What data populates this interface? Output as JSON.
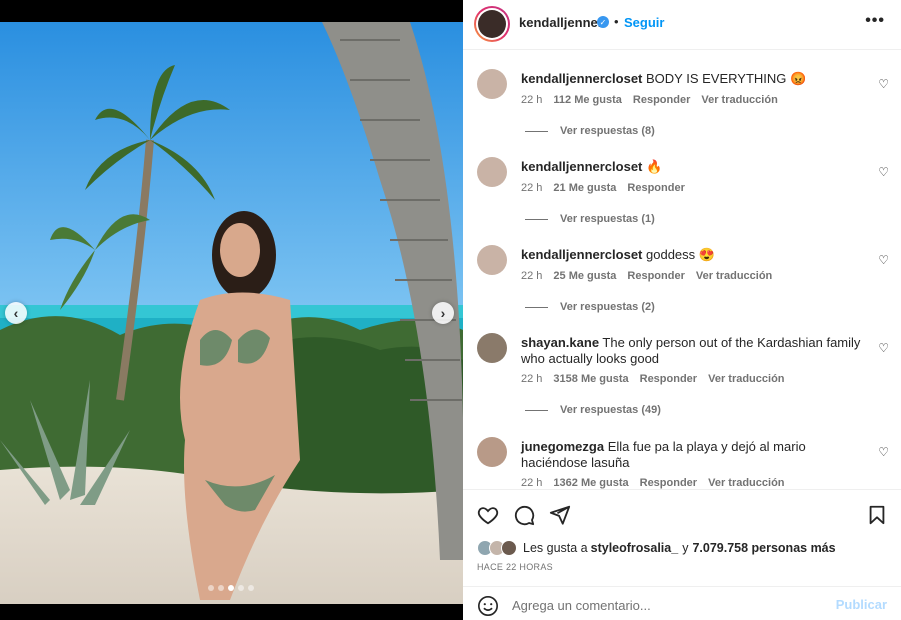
{
  "post": {
    "username": "kendalljenner",
    "follow_label": "Seguir",
    "separator": "•",
    "more": "•••"
  },
  "comments": [
    {
      "user": "kendalljennercloset",
      "text": " BODY IS EVERYTHING 😡",
      "time": "22 h",
      "likes": "112 Me gusta",
      "reply": "Responder",
      "translate": "Ver traducción",
      "replies": "Ver respuestas (8)"
    },
    {
      "user": "kendalljennercloset",
      "text": " 🔥",
      "time": "22 h",
      "likes": "21 Me gusta",
      "reply": "Responder",
      "translate": "",
      "replies": "Ver respuestas (1)"
    },
    {
      "user": "kendalljennercloset",
      "text": " goddess 😍",
      "time": "22 h",
      "likes": "25 Me gusta",
      "reply": "Responder",
      "translate": "Ver traducción",
      "replies": "Ver respuestas (2)"
    },
    {
      "user": "shayan.kane",
      "text": " The only person out of the Kardashian family who actually looks good",
      "time": "22 h",
      "likes": "3158 Me gusta",
      "reply": "Responder",
      "translate": "Ver traducción",
      "replies": "Ver respuestas (49)"
    },
    {
      "user": "junegomezga",
      "text": " Ella fue pa la playa y dejó al mario haciéndose lasuña",
      "time": "22 h",
      "likes": "1362 Me gusta",
      "reply": "Responder",
      "translate": "Ver traducción",
      "replies": ""
    }
  ],
  "likes_line": {
    "prefix": "Les gusta a ",
    "user": "styleofrosalia_",
    "middle": " y ",
    "count": "7.079.758 personas más"
  },
  "timestamp": "HACE 22 HORAS",
  "add_comment": {
    "placeholder": "Agrega un comentario...",
    "publish": "Publicar"
  },
  "colors": {
    "accent": "#0095f6",
    "verified": "#3897f0",
    "publish_disabled": "#b3dbff"
  },
  "icons": [
    "chevron-left-icon",
    "chevron-right-icon",
    "verified-badge-icon",
    "more-icon",
    "heart-icon",
    "comment-icon",
    "share-icon",
    "bookmark-icon",
    "emoji-icon"
  ]
}
